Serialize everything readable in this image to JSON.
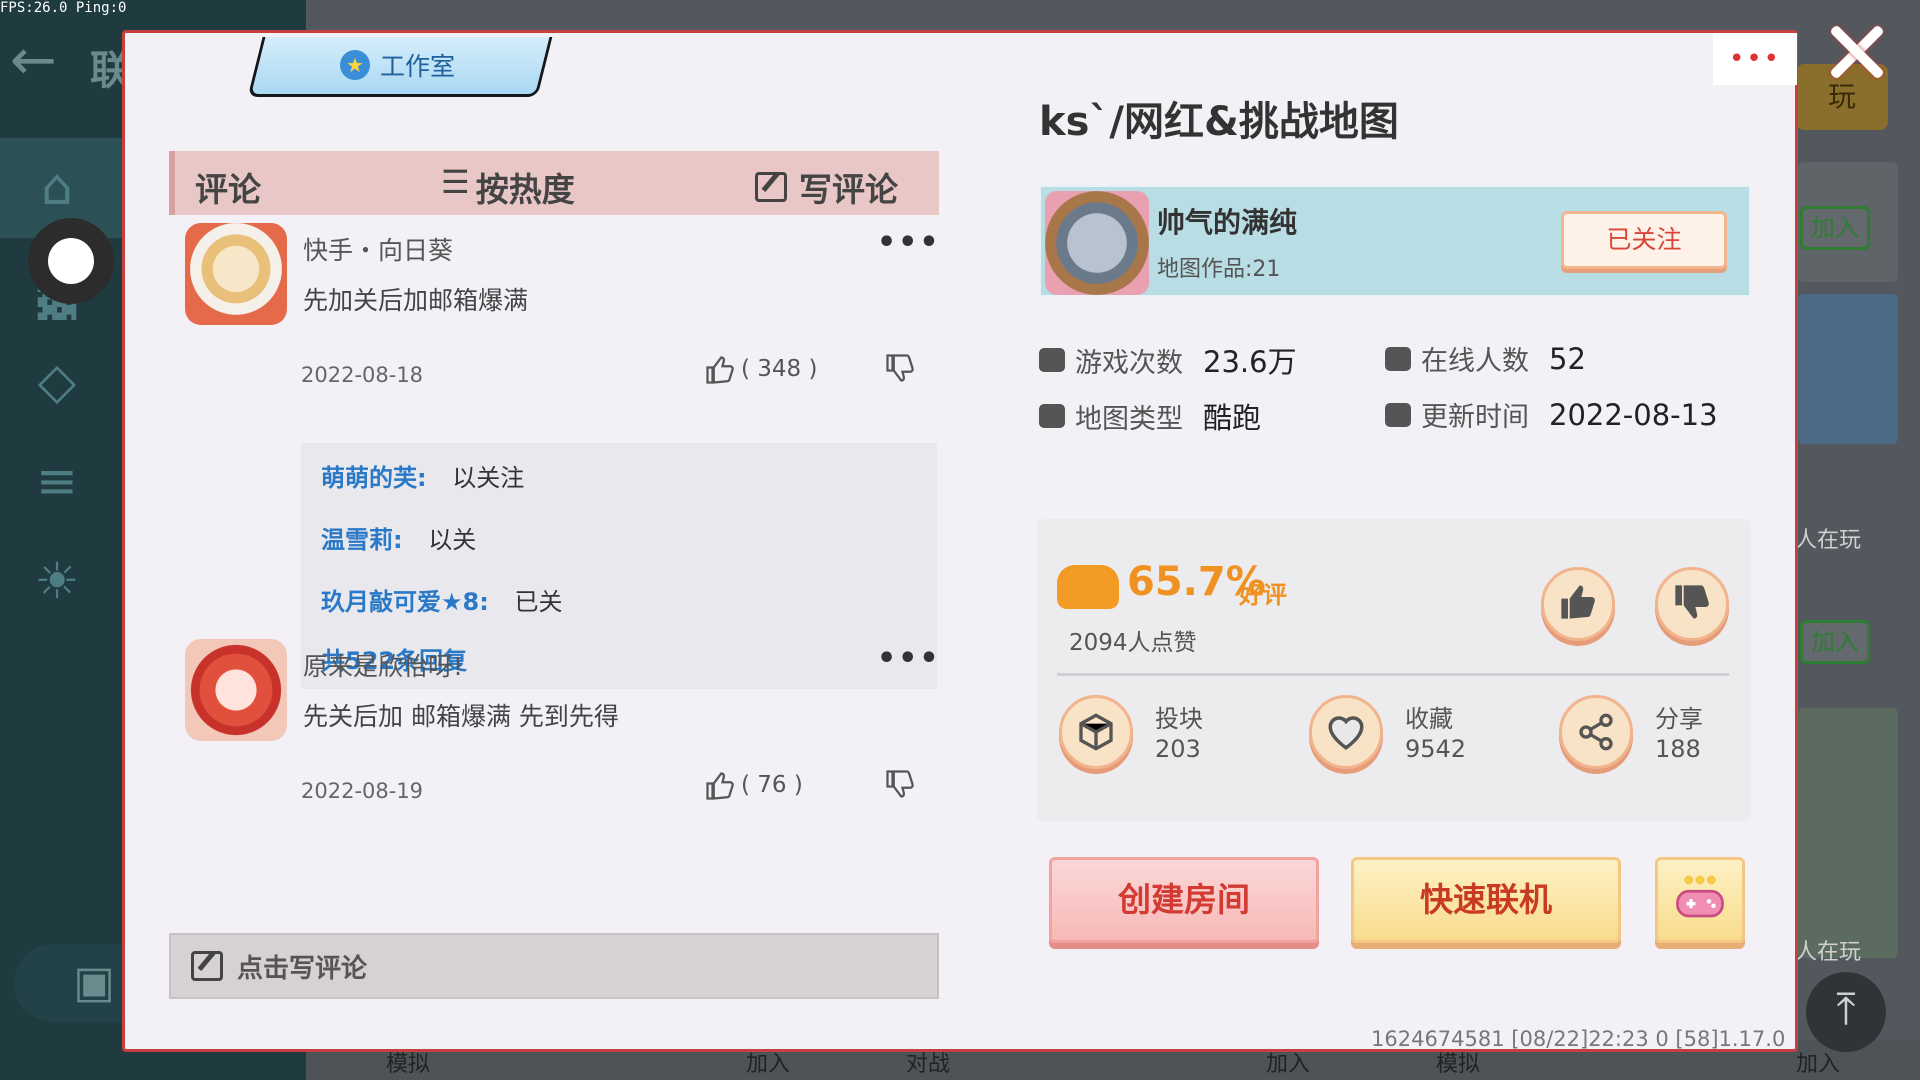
{
  "overlay": {
    "fps_text": "FPS:26.0  Ping:0"
  },
  "background": {
    "title_glyph": "联",
    "play_label": "玩",
    "join_label": "加入",
    "playing_label": "人在玩",
    "bottom_labels": [
      "模拟",
      "加入",
      "对战",
      "加入",
      "模拟",
      "加入"
    ]
  },
  "modal": {
    "studio_tab": "工作室",
    "more_dots": "•••",
    "comments": {
      "header_title": "评论",
      "sort_label": "按热度",
      "write_label": "写评论",
      "items": [
        {
          "name": "快手・向日葵",
          "text": "先加关后加邮箱爆满",
          "date": "2022-08-18",
          "likes": "( 348 )",
          "more": "•••"
        },
        {
          "name": "原来是欣怡呀!",
          "text": "先关后加 邮箱爆满 先到先得",
          "date": "2022-08-19",
          "likes": "( 76 )",
          "more": "•••"
        }
      ],
      "replies": [
        {
          "name": "萌萌的芙:",
          "text": "以关注"
        },
        {
          "name": "温雪莉:",
          "text": "以关"
        },
        {
          "name": "玖月敲可爱★8:",
          "text": "已关"
        }
      ],
      "reply_total": "共522条回复",
      "write_placeholder": "点击写评论"
    },
    "map": {
      "title": "ks`/网红&挑战地图",
      "author_name": "帅气的满纯",
      "author_works": "地图作品:21",
      "follow_label": "已关注",
      "stats": {
        "plays_label": "游戏次数",
        "plays_value": "23.6万",
        "online_label": "在线人数",
        "online_value": "52",
        "type_label": "地图类型",
        "type_value": "酷跑",
        "update_label": "更新时间",
        "update_value": "2022-08-13"
      },
      "rating": {
        "percent": "65.7%",
        "good_label": "好评",
        "likes_text": "2094人点赞"
      },
      "actions": [
        {
          "label": "投块",
          "value": "203",
          "icon": "block-icon"
        },
        {
          "label": "收藏",
          "value": "9542",
          "icon": "heart-icon"
        },
        {
          "label": "分享",
          "value": "188",
          "icon": "share-icon"
        }
      ],
      "create_room_label": "创建房间",
      "quick_play_label": "快速联机"
    },
    "footer_info": "1624674581   [08/22]22:23 0   [58]1.17.0"
  },
  "colors": {
    "accent_red": "#d23a32",
    "accent_orange": "#f09222",
    "link_blue": "#2a79c8",
    "modal_border": "#c64040"
  }
}
